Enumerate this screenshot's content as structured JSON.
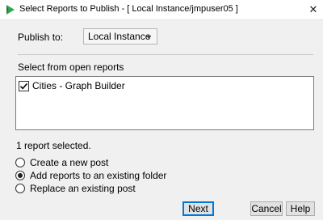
{
  "window": {
    "title": "Select Reports to Publish - [ Local Instance/jmpuser05 ]",
    "close_glyph": "✕"
  },
  "publish": {
    "label": "Publish to:",
    "selected": "Local Instance"
  },
  "reports": {
    "section_label": "Select from open reports",
    "items": [
      {
        "label": "Cities - Graph Builder",
        "checked": true
      }
    ],
    "status": "1 report selected."
  },
  "options": [
    {
      "label": "Create a new post",
      "selected": false
    },
    {
      "label": "Add reports to an existing folder",
      "selected": true
    },
    {
      "label": "Replace an existing post",
      "selected": false
    }
  ],
  "buttons": {
    "next": "Next",
    "cancel": "Cancel",
    "help": "Help"
  },
  "colors": {
    "icon_green": "#2fa84f",
    "default_button_border": "#0078d7"
  }
}
